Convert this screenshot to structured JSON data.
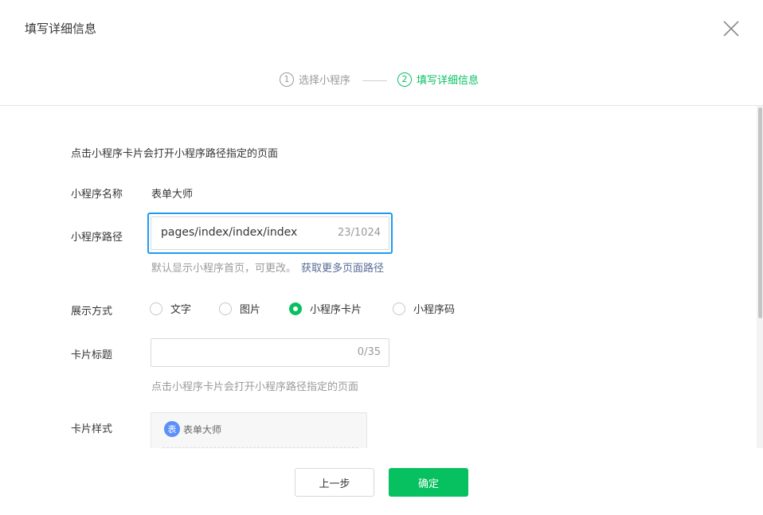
{
  "dialog": {
    "title": "填写详细信息",
    "close_icon": "close-icon"
  },
  "steps": [
    {
      "num": "1",
      "label": "选择小程序",
      "state": "done"
    },
    {
      "num": "2",
      "label": "填写详细信息",
      "state": "active"
    }
  ],
  "form": {
    "description": "点击小程序卡片会打开小程序路径指定的页面",
    "name": {
      "label": "小程序名称",
      "value": "表单大师"
    },
    "path": {
      "label": "小程序路径",
      "value": "pages/index/index/index",
      "count": "23/1024",
      "hint": "默认显示小程序首页，可更改。",
      "link": "获取更多页面路径"
    },
    "display": {
      "label": "展示方式",
      "options": [
        "文字",
        "图片",
        "小程序卡片",
        "小程序码"
      ],
      "selected": "小程序卡片"
    },
    "card_title": {
      "label": "卡片标题",
      "count": "0/35",
      "hint": "点击小程序卡片会打开小程序路径指定的页面"
    },
    "card_style": {
      "label": "卡片样式",
      "avatar_char": "表",
      "name": "表单大师"
    }
  },
  "buttons": {
    "prev": "上一步",
    "confirm": "确定"
  },
  "colors": {
    "accent": "#07c160",
    "focus_border": "#1e9bf0",
    "link": "#576b95",
    "muted": "#9a9a9a"
  }
}
